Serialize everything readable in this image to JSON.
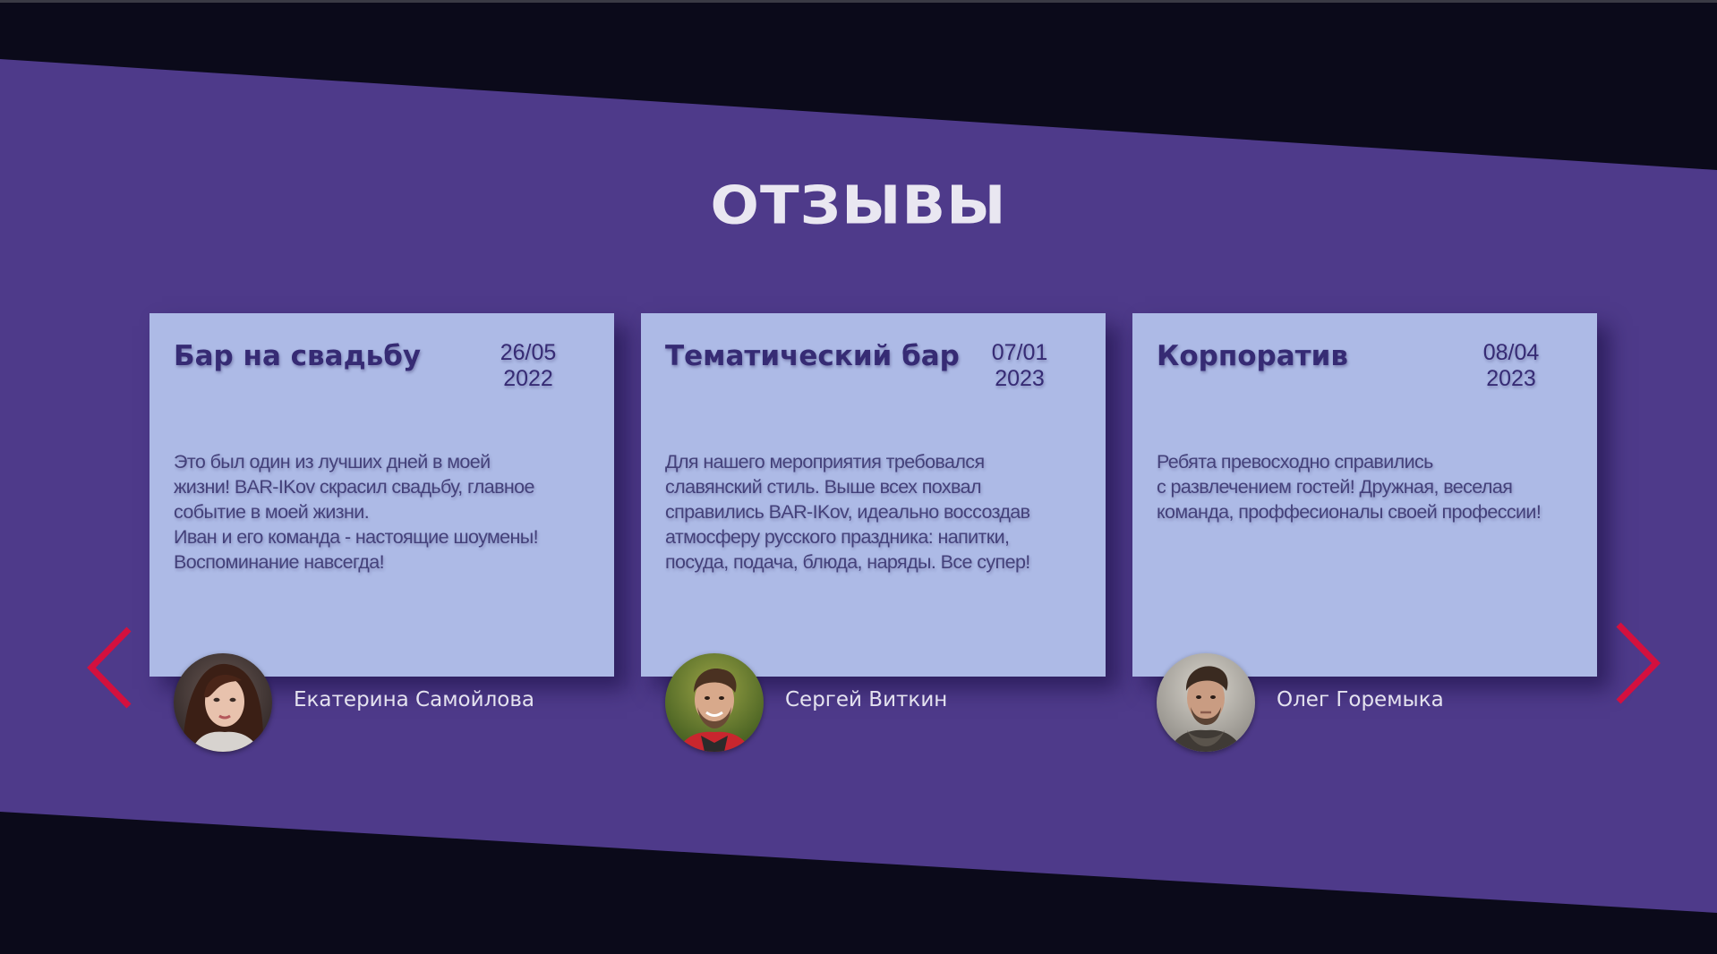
{
  "section": {
    "title": "ОТЗЫВЫ"
  },
  "colors": {
    "background": "#0b0a1a",
    "band": "#4e3a8a",
    "card": "#adbae6",
    "card_title": "#362b74",
    "arrow": "#d4103e"
  },
  "navigation": {
    "prev_icon": "chevron-left-icon",
    "next_icon": "chevron-right-icon"
  },
  "reviews": [
    {
      "title": "Бар на свадьбу",
      "date_day_month": "26/05",
      "date_year": "2022",
      "text": "Это был один из лучших дней в моей\nжизни! BAR-IKov скрасил свадьбу, главное\nсобытие в моей жизни.\nИван и его команда - настоящие шоумены!\nВоспоминание навсегда!",
      "author": "Екатерина Самойлова",
      "avatar_icon": "avatar-photo"
    },
    {
      "title": "Тематический бар",
      "date_day_month": "07/01",
      "date_year": "2023",
      "text": "Для нашего мероприятия требовался\nславянский стиль. Выше всех похвал\nсправились BAR-IKov, идеально воссоздав\nатмосферу русского праздника: напитки,\nпосуда, подача, блюда, наряды. Все супер!",
      "author": "Сергей Виткин",
      "avatar_icon": "avatar-photo"
    },
    {
      "title": "Корпоратив",
      "date_day_month": "08/04",
      "date_year": "2023",
      "text": "Ребята превосходно справились\nс развлечением гостей! Дружная, веселая\nкоманда, проффесионалы своей профессии!",
      "author": "Олег Горемыка",
      "avatar_icon": "avatar-photo"
    }
  ]
}
